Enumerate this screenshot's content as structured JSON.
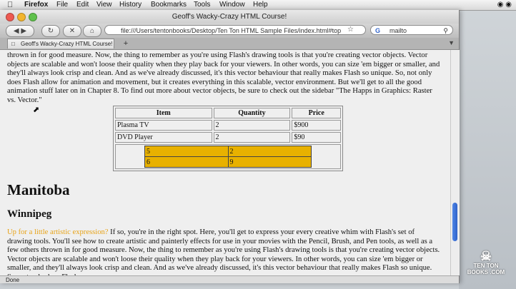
{
  "menubar": {
    "app": "Firefox",
    "items": [
      "File",
      "Edit",
      "View",
      "History",
      "Bookmarks",
      "Tools",
      "Window",
      "Help"
    ]
  },
  "window": {
    "title": "Geoff's Wacky-Crazy HTML Course!"
  },
  "toolbar": {
    "url": "file:///Users/tentonbooks/Desktop/Ten Ton HTML Sample Files/index.html#top",
    "search_value": "mailto"
  },
  "tabs": [
    {
      "label": "Geoff's Wacky-Crazy HTML Course!"
    }
  ],
  "content": {
    "intro": "thrown in for good measure. Now, the thing to remember as you're using Flash's drawing tools is that you're creating vector objects. Vector objects are scalable and won't loose their quality when they play back for your viewers. In other words, you can size 'em bigger or smaller, and they'll always look crisp and clean. And as we've already discussed, it's this vector behaviour that really makes Flash so unique. So, not only does Flash allow for animation and movement, but it creates everything in this scalable, vector environment. But we'll get to all the good animation stuff later on in Chapter 8. To find out more about vector objects, be sure to check out the sidebar \"The Happs in Graphics: Raster vs. Vector.\"",
    "table": {
      "headers": [
        "Item",
        "Quantity",
        "Price"
      ],
      "rows": [
        [
          "Plasma TV",
          "2",
          "$900"
        ],
        [
          "DVD Player",
          "2",
          "$90"
        ]
      ],
      "nested_rows": [
        [
          "5",
          "2"
        ],
        [
          "6",
          "9"
        ]
      ],
      "nested_color": "#e8b100"
    },
    "heading1": "Manitoba",
    "heading2": "Winnipeg",
    "link_text": "Up for a little artistic expression?",
    "body": " If so, you're in the right spot. Here, you'll get to express your every creative whim with Flash's set of drawing tools. You'll see how to create artistic and painterly effects for use in your movies with the Pencil, Brush, and Pen tools, as well as a few others thrown in for good measure. Now, the thing to remember as you're using Flash's drawing tools is that you're creating vector objects. Vector objects are scalable and won't loose their quality when they play back for your viewers. In other words, you can size 'em bigger or smaller, and they'll always look crisp and clean. And as we've already discussed, it's this vector behaviour that really makes Flash so unique. So, not only does Flash"
  },
  "status": "Done",
  "watermark": "TEN TON BOOKS .COM"
}
